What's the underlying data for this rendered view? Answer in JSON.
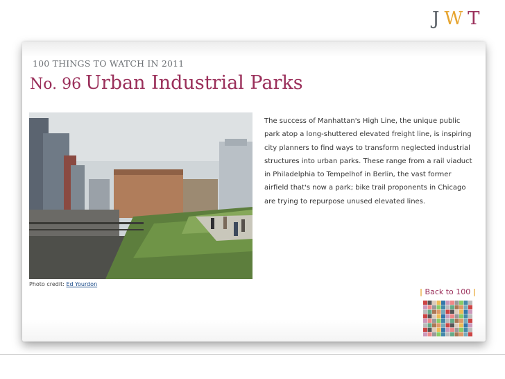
{
  "logo": {
    "j": "J",
    "w": "W",
    "t": "T"
  },
  "slide": {
    "kicker": "100 THINGS TO WATCH IN 2011",
    "number": "No. 96",
    "title": "Urban Industrial Parks",
    "body": "The success of Manhattan's High Line, the unique public park atop a long-shuttered elevated freight line, is inspiring city planners to find ways to transform neglected industrial structures into urban parks. These range from a rail viaduct in Philadelphia to Tempelhof in Berlin, the vast former airfield that's now a park; bike trail proponents in Chicago are trying to repurpose unused elevated lines.",
    "photo_credit_label": "Photo credit:",
    "photo_credit_name": "Ed Yourdon",
    "back_label": "Back to 100",
    "back_bar": "|"
  },
  "colors": {
    "accent": "#9a2f5a",
    "gold": "#e6a531",
    "gray": "#5a6066"
  }
}
